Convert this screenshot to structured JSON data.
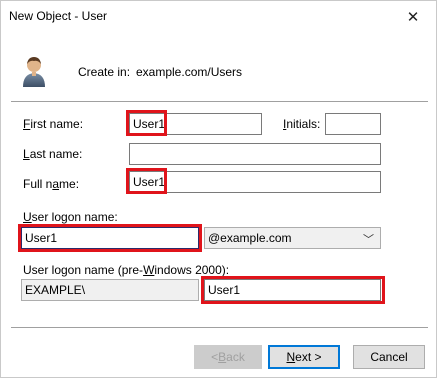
{
  "window": {
    "title": "New Object - User",
    "close_glyph": "✕"
  },
  "header": {
    "create_in_label": "Create in:",
    "create_in_value": "example.com/Users",
    "icon": "user-icon"
  },
  "form": {
    "first_name": {
      "label_accel": "F",
      "label_rest": "irst name:",
      "value": "User1"
    },
    "initials": {
      "label_accel": "I",
      "label_rest": "nitials:",
      "value": ""
    },
    "last_name": {
      "label_accel": "L",
      "label_rest": "ast name:",
      "value": ""
    },
    "full_name": {
      "label_pre": "Full n",
      "label_accel": "a",
      "label_rest": "me:",
      "value": "User1"
    },
    "logon_name": {
      "label_accel": "U",
      "label_rest": "ser logon name:",
      "value": "User1"
    },
    "domain_select": {
      "value": "@example.com",
      "chevron": "﹀"
    },
    "pre2000": {
      "label_pre": "User logon name (pre-",
      "label_accel": "W",
      "label_rest": "indows 2000):",
      "domain": "EXAMPLE\\",
      "value": "User1"
    }
  },
  "buttons": {
    "back": {
      "accel": "B",
      "pre": "< ",
      "rest": "ack"
    },
    "next": {
      "accel": "N",
      "rest": "ext >"
    },
    "cancel": "Cancel"
  },
  "colors": {
    "highlight": "#e0141b",
    "accent": "#0078d7"
  }
}
